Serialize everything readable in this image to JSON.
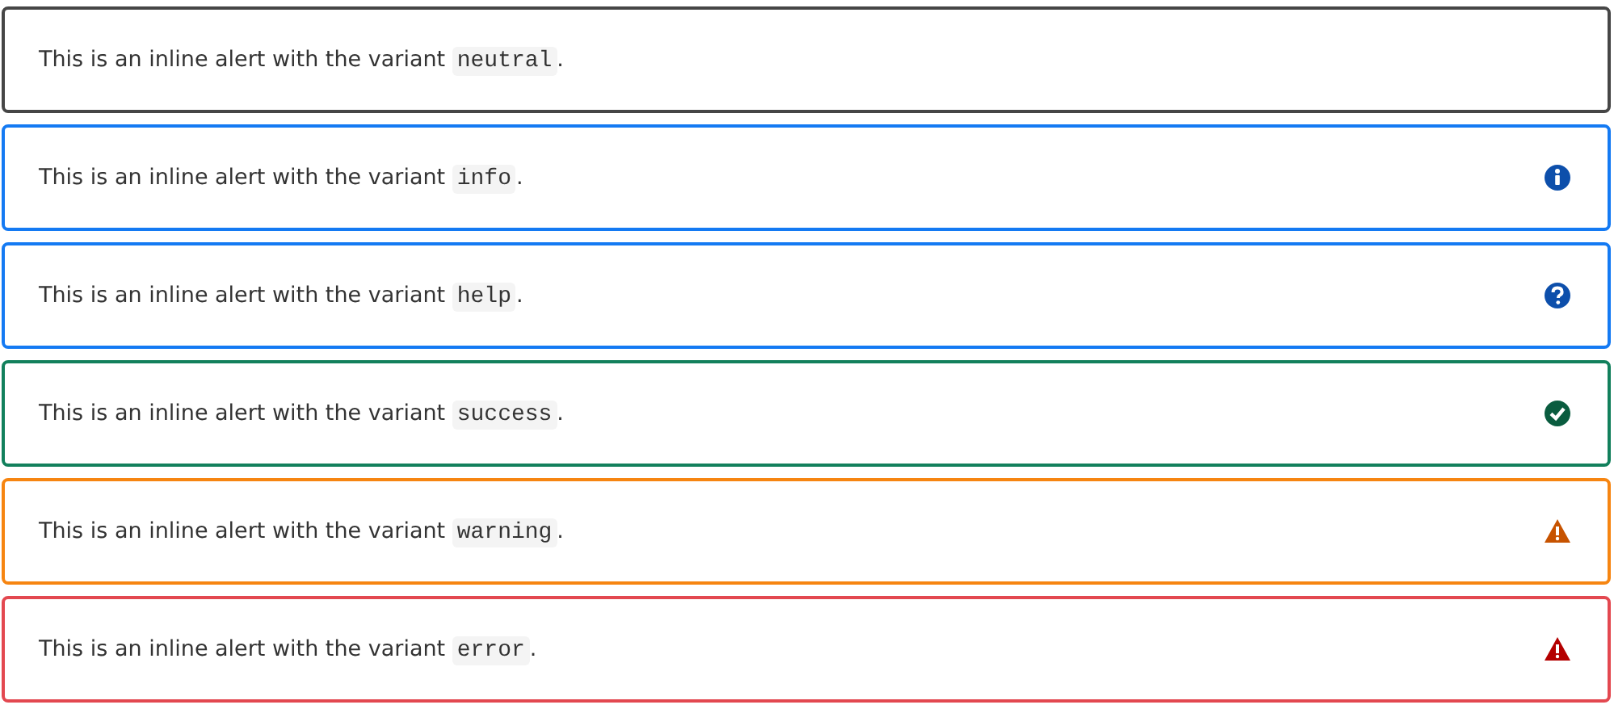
{
  "alerts": [
    {
      "kind": "neutral",
      "text": "This is an inline alert with the variant",
      "code": "neutral",
      "end": "."
    },
    {
      "kind": "info",
      "text": "This is an inline alert with the variant",
      "code": "info",
      "end": "."
    },
    {
      "kind": "help",
      "text": "This is an inline alert with the variant",
      "code": "help",
      "end": "."
    },
    {
      "kind": "success",
      "text": "This is an inline alert with the variant",
      "code": "success",
      "end": "."
    },
    {
      "kind": "warning",
      "text": "This is an inline alert with the variant",
      "code": "warning",
      "end": "."
    },
    {
      "kind": "error",
      "text": "This is an inline alert with the variant",
      "code": "error",
      "end": "."
    }
  ]
}
